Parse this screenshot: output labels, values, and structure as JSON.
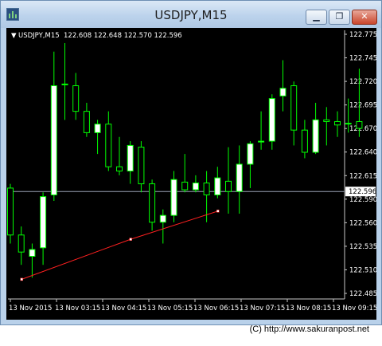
{
  "window": {
    "title": "USDJPY,M15",
    "icon": "chart-app-icon",
    "controls": {
      "minimize_icon": "minimize-icon",
      "restore_icon": "restore-icon",
      "close_icon": "close-icon"
    },
    "minimize_glyph": "▁",
    "restore_glyph": "❐",
    "close_glyph": "✕"
  },
  "header": {
    "symbol": "USDJPY,M15",
    "ohlc": "122.608 122.648 122.570 122.596",
    "menu_glyph": "▼"
  },
  "colors": {
    "background": "#000000",
    "bull_body": "#ffffff",
    "bear_body": "#000000",
    "candle_outline": "#00ff00",
    "price_line": "#9aa3b5",
    "trendline": "#ff2020",
    "text": "#ffffff"
  },
  "chart_data": {
    "type": "candlestick",
    "title": "USDJPY,M15",
    "y_ticks": [
      "122.775",
      "122.745",
      "122.720",
      "122.695",
      "122.670",
      "122.640",
      "122.615",
      "122.590",
      "122.560",
      "122.535",
      "122.510",
      "122.485"
    ],
    "x_ticks": [
      "13 Nov 2015",
      "13 Nov 03:15",
      "13 Nov 04:15",
      "13 Nov 05:15",
      "13 Nov 06:15",
      "13 Nov 07:15",
      "13 Nov 08:15",
      "13 Nov 09:15"
    ],
    "current_price": "122.596",
    "ylim": [
      122.47,
      122.785
    ],
    "candles": [
      {
        "o": 122.6,
        "h": 122.605,
        "l": 122.535,
        "c": 122.545
      },
      {
        "o": 122.545,
        "h": 122.555,
        "l": 122.51,
        "c": 122.525
      },
      {
        "o": 122.52,
        "h": 122.535,
        "l": 122.495,
        "c": 122.528
      },
      {
        "o": 122.53,
        "h": 122.595,
        "l": 122.51,
        "c": 122.59
      },
      {
        "o": 122.592,
        "h": 122.76,
        "l": 122.585,
        "c": 122.72
      },
      {
        "o": 122.722,
        "h": 122.77,
        "l": 122.68,
        "c": 122.722
      },
      {
        "o": 122.72,
        "h": 122.735,
        "l": 122.68,
        "c": 122.69
      },
      {
        "o": 122.69,
        "h": 122.7,
        "l": 122.66,
        "c": 122.665
      },
      {
        "o": 122.665,
        "h": 122.68,
        "l": 122.64,
        "c": 122.675
      },
      {
        "o": 122.675,
        "h": 122.69,
        "l": 122.62,
        "c": 122.625
      },
      {
        "o": 122.625,
        "h": 122.66,
        "l": 122.615,
        "c": 122.62
      },
      {
        "o": 122.62,
        "h": 122.655,
        "l": 122.605,
        "c": 122.65
      },
      {
        "o": 122.648,
        "h": 122.655,
        "l": 122.595,
        "c": 122.605
      },
      {
        "o": 122.605,
        "h": 122.61,
        "l": 122.55,
        "c": 122.56
      },
      {
        "o": 122.56,
        "h": 122.575,
        "l": 122.535,
        "c": 122.568
      },
      {
        "o": 122.568,
        "h": 122.62,
        "l": 122.56,
        "c": 122.61
      },
      {
        "o": 122.607,
        "h": 122.64,
        "l": 122.595,
        "c": 122.598
      },
      {
        "o": 122.598,
        "h": 122.615,
        "l": 122.595,
        "c": 122.606
      },
      {
        "o": 122.606,
        "h": 122.62,
        "l": 122.56,
        "c": 122.592
      },
      {
        "o": 122.592,
        "h": 122.625,
        "l": 122.588,
        "c": 122.612
      },
      {
        "o": 122.608,
        "h": 122.648,
        "l": 122.57,
        "c": 122.596
      },
      {
        "o": 122.596,
        "h": 122.65,
        "l": 122.57,
        "c": 122.628
      },
      {
        "o": 122.628,
        "h": 122.655,
        "l": 122.6,
        "c": 122.652
      },
      {
        "o": 122.654,
        "h": 122.69,
        "l": 122.645,
        "c": 122.655
      },
      {
        "o": 122.655,
        "h": 122.71,
        "l": 122.645,
        "c": 122.705
      },
      {
        "o": 122.708,
        "h": 122.75,
        "l": 122.69,
        "c": 122.717
      },
      {
        "o": 122.72,
        "h": 122.725,
        "l": 122.65,
        "c": 122.668
      },
      {
        "o": 122.668,
        "h": 122.68,
        "l": 122.635,
        "c": 122.642
      },
      {
        "o": 122.642,
        "h": 122.7,
        "l": 122.64,
        "c": 122.68
      },
      {
        "o": 122.68,
        "h": 122.695,
        "l": 122.65,
        "c": 122.678
      },
      {
        "o": 122.678,
        "h": 122.69,
        "l": 122.66,
        "c": 122.674
      },
      {
        "o": 122.676,
        "h": 122.705,
        "l": 122.665,
        "c": 122.676
      },
      {
        "o": 122.678,
        "h": 122.74,
        "l": 122.66,
        "c": 122.67
      }
    ],
    "trendline": [
      {
        "candle": 1,
        "price": 122.493
      },
      {
        "candle": 11,
        "price": 122.54
      },
      {
        "candle": 19,
        "price": 122.573
      }
    ]
  },
  "footer": {
    "copyright": "(C) http://www.sakuranpost.net"
  }
}
